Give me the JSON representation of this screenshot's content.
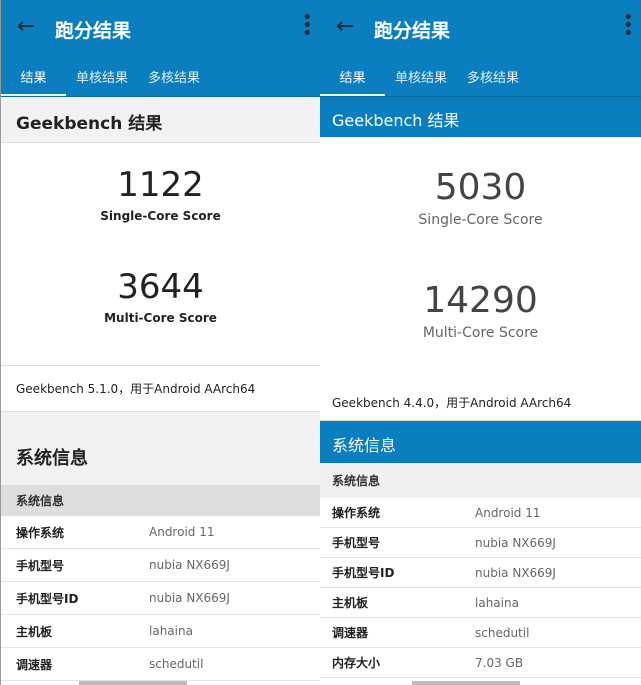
{
  "left": {
    "appbar": {
      "title": "跑分结果"
    },
    "tabs": [
      "结果",
      "单核结果",
      "多核结果"
    ],
    "section_title": "Geekbench 结果",
    "single": {
      "score": "1122",
      "label": "Single-Core Score"
    },
    "multi": {
      "score": "3644",
      "label": "Multi-Core Score"
    },
    "version": "Geekbench 5.1.0，用于Android AArch64",
    "sysinfo_title": "系统信息",
    "sysinfo_sub": "系统信息",
    "rows": [
      {
        "k": "操作系统",
        "v": "Android 11"
      },
      {
        "k": "手机型号",
        "v": "nubia NX669J"
      },
      {
        "k": "手机型号ID",
        "v": "nubia NX669J"
      },
      {
        "k": "主机板",
        "v": "lahaina"
      },
      {
        "k": "调速器",
        "v": "schedutil"
      }
    ]
  },
  "right": {
    "appbar": {
      "title": "跑分结果"
    },
    "tabs": [
      "结果",
      "单核结果",
      "多核结果"
    ],
    "section_title": "Geekbench 结果",
    "single": {
      "score": "5030",
      "label": "Single-Core Score"
    },
    "multi": {
      "score": "14290",
      "label": "Multi-Core Score"
    },
    "version": "Geekbench 4.4.0，用于Android AArch64",
    "sysinfo_title": "系统信息",
    "sysinfo_sub": "系统信息",
    "rows": [
      {
        "k": "操作系统",
        "v": "Android 11"
      },
      {
        "k": "手机型号",
        "v": "nubia NX669J"
      },
      {
        "k": "手机型号ID",
        "v": "nubia NX669J"
      },
      {
        "k": "主机板",
        "v": "lahaina"
      },
      {
        "k": "调速器",
        "v": "schedutil"
      },
      {
        "k": "内存大小",
        "v": "7.03 GB"
      }
    ]
  },
  "colors": {
    "accent": "#0a7ebf"
  }
}
